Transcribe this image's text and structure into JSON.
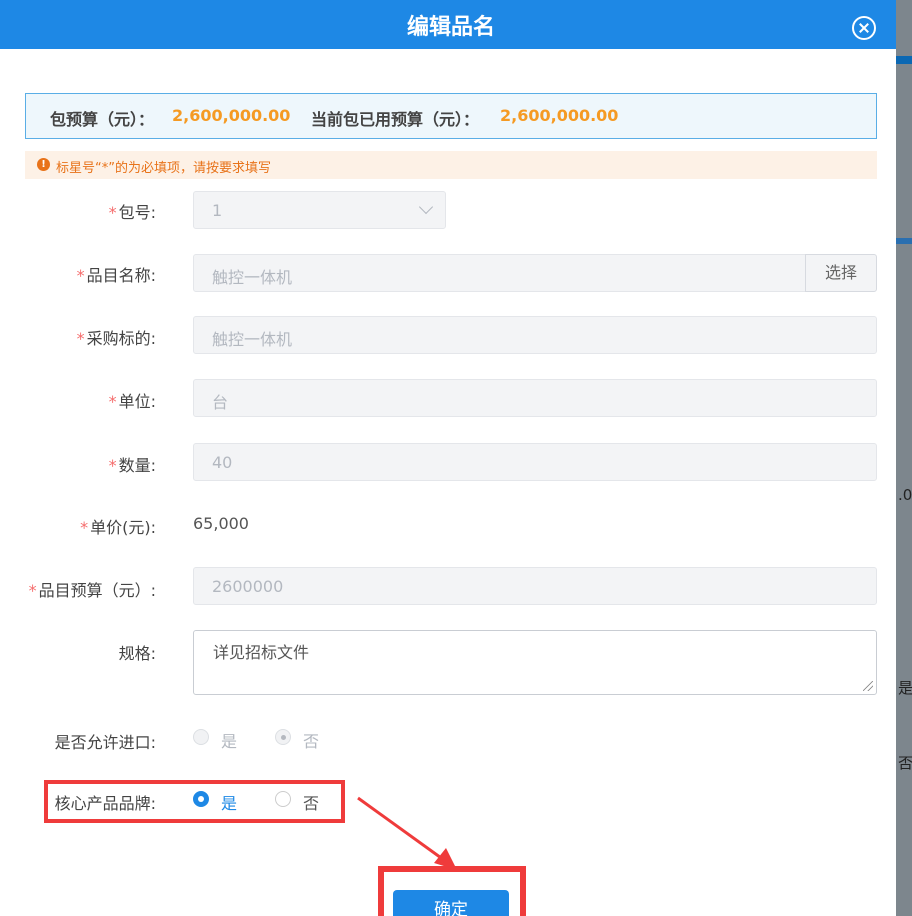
{
  "modal": {
    "title": "编辑品名"
  },
  "budget": {
    "package_label": "包预算（元）：",
    "package_value": "2,600,000.00",
    "used_label": "当前包已用预算（元）：",
    "used_value": "2,600,000.00"
  },
  "notice": {
    "icon": "info-icon",
    "text": "标星号“*”的为必填项，请按要求填写"
  },
  "form": {
    "required_mark": "*",
    "package_no": {
      "label": "包号:",
      "value": "1"
    },
    "item_name": {
      "label": "品目名称:",
      "value": "触控一体机",
      "button": "选择"
    },
    "target": {
      "label": "采购标的:",
      "value": "触控一体机"
    },
    "unit": {
      "label": "单位:",
      "value": "台"
    },
    "quantity": {
      "label": "数量:",
      "value": "40"
    },
    "unit_price": {
      "label": "单价(元):",
      "value": "65,000"
    },
    "item_budget": {
      "label": "品目预算（元）:",
      "value": "2600000"
    },
    "spec": {
      "label": "规格:",
      "value": "详见招标文件"
    },
    "import_allowed": {
      "label": "是否允许进口:",
      "yes": "是",
      "no": "否",
      "selected": "否"
    },
    "core_brand": {
      "label": "核心产品品牌:",
      "yes": "是",
      "no": "否",
      "selected": "是"
    }
  },
  "footer": {
    "confirm_label": "确定"
  },
  "background": {
    "frag1": ".0",
    "frag2": "是",
    "frag3": "否"
  },
  "colors": {
    "primary": "#1e88e5",
    "accent_orange": "#f59a23",
    "highlight": "#ef3b3b"
  }
}
